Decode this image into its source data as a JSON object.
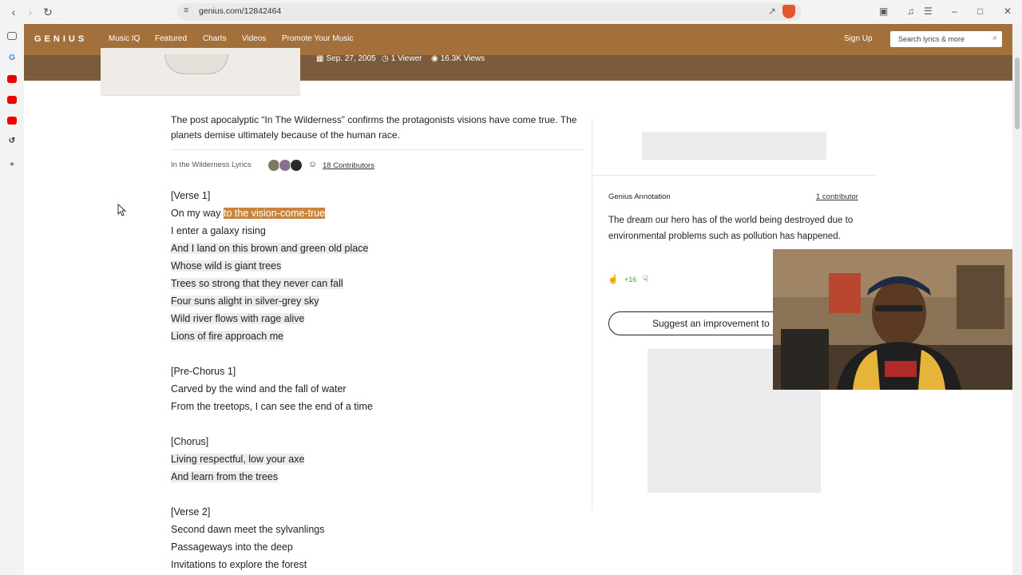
{
  "browser": {
    "url": "genius.com/12842464"
  },
  "header": {
    "logo": "GENIUS",
    "nav": [
      "Music IQ",
      "Featured",
      "Charts",
      "Videos",
      "Promote Your Music"
    ],
    "signup": "Sign Up",
    "search_placeholder": "Search lyrics & more"
  },
  "song_meta": {
    "date": "Sep. 27, 2005",
    "viewers": "1 Viewer",
    "views": "16.3K Views"
  },
  "about": "The post apocalyptic “In The Wilderness” confirms the protagonists visions have come true. The planets demise ultimately because of the human race.",
  "lyrics_header": {
    "title": "In the Wilderness Lyrics",
    "contributors": "18 Contributors"
  },
  "lyrics": {
    "verse1_tag": "[Verse 1]",
    "line1_pre": "On my way ",
    "line1_sel": "to the vision-come-true",
    "line2": "I enter a galaxy rising",
    "line3": "And I land on this brown and green old place",
    "line4": "Whose wild is giant trees",
    "line5": "Trees so strong that they never can fall",
    "line6": "Four suns alight in silver-grey sky",
    "line7": "Wild river flows with rage alive",
    "line8": "Lions of fire approach me",
    "prechorus_tag": "[Pre-Chorus 1]",
    "line9": "Carved by the wind and the fall of water",
    "line10": "From the treetops, I can see the end of a time",
    "chorus_tag": "[Chorus]",
    "line11": "Living respectful, low your axe",
    "line12": "And learn from the trees",
    "verse2_tag": "[Verse 2]",
    "line13": "Second dawn meet the sylvanlings",
    "line14": "Passageways into the deep",
    "line15": "Invitations to explore the forest"
  },
  "annotation": {
    "label": "Genius Annotation",
    "contributors": "1 contributor",
    "text": "The dream our hero has of the world being destroyed due to environmental problems such as pollution has happened.",
    "votes": "+16",
    "suggest": "Suggest an improvement to"
  }
}
